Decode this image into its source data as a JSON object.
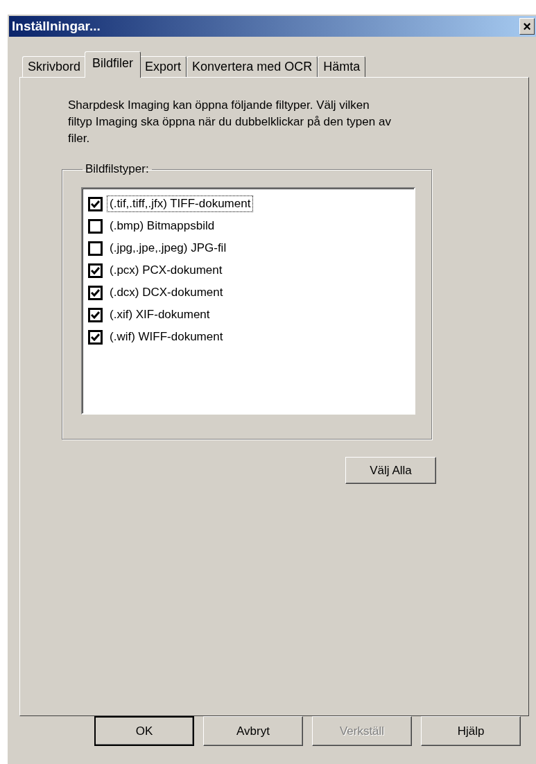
{
  "window": {
    "title": "Inställningar...",
    "close": "×"
  },
  "tabs": [
    {
      "label": "Skrivbord",
      "selected": false
    },
    {
      "label": "Bildfiler",
      "selected": true
    },
    {
      "label": "Export",
      "selected": false
    },
    {
      "label": "Konvertera med OCR",
      "selected": false
    },
    {
      "label": "Hämta",
      "selected": false
    }
  ],
  "description": "Sharpdesk Imaging kan öppna följande filtyper. Välj vilken filtyp Imaging ska öppna när du dubbelklickar på den typen av filer.",
  "group": {
    "label": "Bildfilstyper:",
    "items": [
      {
        "label": "(.tif,.tiff,.jfx) TIFF-dokument",
        "checked": true,
        "focused": true
      },
      {
        "label": "(.bmp) Bitmappsbild",
        "checked": false,
        "focused": false
      },
      {
        "label": "(.jpg,.jpe,.jpeg) JPG-fil",
        "checked": false,
        "focused": false
      },
      {
        "label": "(.pcx) PCX-dokument",
        "checked": true,
        "focused": false
      },
      {
        "label": "(.dcx) DCX-dokument",
        "checked": true,
        "focused": false
      },
      {
        "label": "(.xif) XIF-dokument",
        "checked": true,
        "focused": false
      },
      {
        "label": "(.wif) WIFF-dokument",
        "checked": true,
        "focused": false
      }
    ]
  },
  "select_all_button": "Välj Alla",
  "buttons": [
    {
      "label": "OK",
      "default": true,
      "disabled": false
    },
    {
      "label": "Avbryt",
      "default": false,
      "disabled": false
    },
    {
      "label": "Verkställ",
      "default": false,
      "disabled": true
    },
    {
      "label": "Hjälp",
      "default": false,
      "disabled": false
    }
  ]
}
